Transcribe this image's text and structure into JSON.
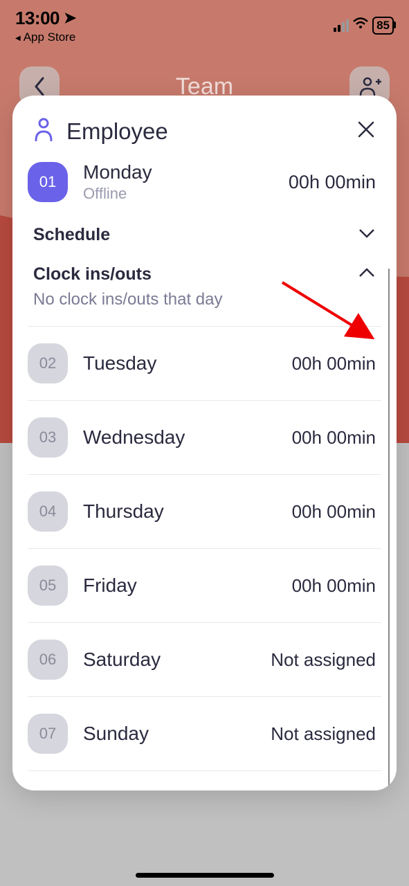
{
  "status": {
    "time": "13:00",
    "back_app": "App Store",
    "battery": "85"
  },
  "header": {
    "title": "Team"
  },
  "modal": {
    "title": "Employee",
    "active_day": {
      "num": "01",
      "name": "Monday",
      "status": "Offline",
      "time": "00h 00min"
    },
    "schedule_label": "Schedule",
    "clockins_label": "Clock ins/outs",
    "clockins_empty": "No clock ins/outs that day",
    "days": [
      {
        "num": "02",
        "name": "Tuesday",
        "value": "00h 00min"
      },
      {
        "num": "03",
        "name": "Wednesday",
        "value": "00h 00min"
      },
      {
        "num": "04",
        "name": "Thursday",
        "value": "00h 00min"
      },
      {
        "num": "05",
        "name": "Friday",
        "value": "00h 00min"
      },
      {
        "num": "06",
        "name": "Saturday",
        "value": "Not assigned"
      },
      {
        "num": "07",
        "name": "Sunday",
        "value": "Not assigned"
      }
    ]
  }
}
